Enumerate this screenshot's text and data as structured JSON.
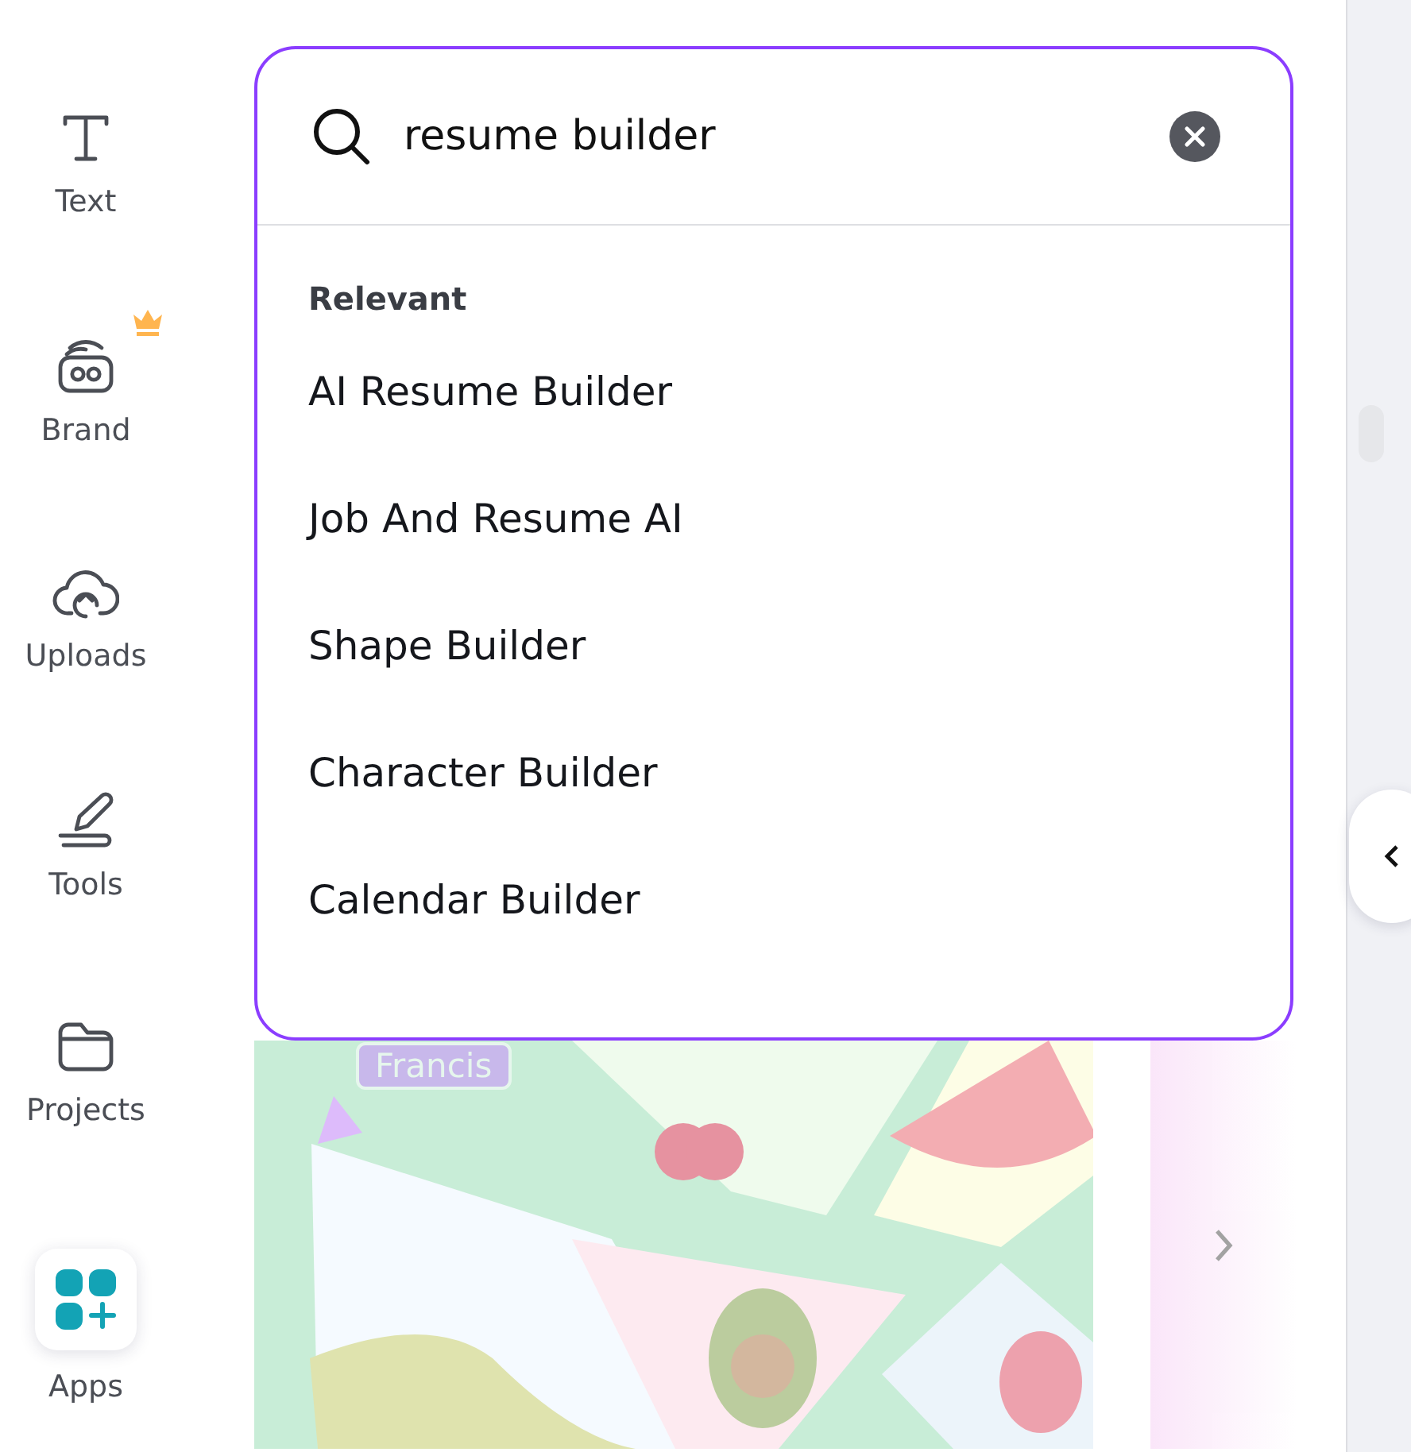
{
  "sidebar": {
    "items": [
      {
        "kind": "text",
        "label": "Text",
        "premium": false
      },
      {
        "kind": "brand",
        "label": "Brand",
        "premium": true
      },
      {
        "kind": "uploads",
        "label": "Uploads",
        "premium": false
      },
      {
        "kind": "tools",
        "label": "Tools",
        "premium": false
      },
      {
        "kind": "projects",
        "label": "Projects",
        "premium": false
      },
      {
        "kind": "apps",
        "label": "Apps",
        "premium": false
      }
    ]
  },
  "search": {
    "value": "resume builder"
  },
  "suggestions": {
    "heading": "Relevant",
    "items": [
      "AI Resume Builder",
      "Job And Resume AI",
      "Shape Builder",
      "Character Builder",
      "Calendar Builder"
    ]
  },
  "template": {
    "collaborator": "Francis"
  }
}
